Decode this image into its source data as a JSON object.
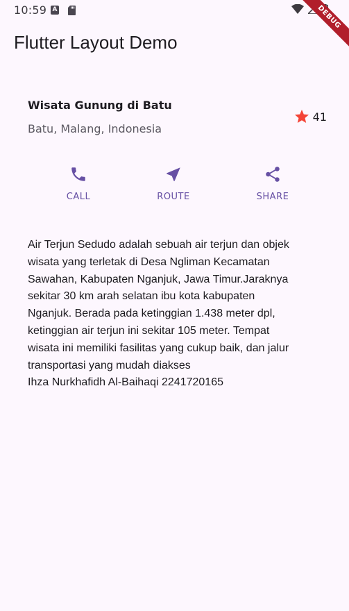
{
  "status_bar": {
    "time": "10:59",
    "a_badge": "A"
  },
  "debug_banner": "DEBUG",
  "app_bar": {
    "title": "Flutter Layout Demo"
  },
  "title_section": {
    "name": "Wisata Gunung di Batu",
    "location": "Batu, Malang, Indonesia",
    "rating_count": "41",
    "star_color": "#f44336"
  },
  "buttons": {
    "call_label": "CALL",
    "route_label": "ROUTE",
    "share_label": "SHARE",
    "accent_color": "#6750a4"
  },
  "description": {
    "lines": [
      "Air Terjun Sedudo adalah sebuah air terjun dan objek",
      "wisata yang terletak di Desa Ngliman Kecamatan",
      "Sawahan, Kabupaten Nganjuk, Jawa Timur.Jaraknya",
      "sekitar 30 km arah selatan ibu kota kabupaten",
      "Nganjuk. Berada pada ketinggian 1.438 meter dpl,",
      "ketinggian air terjun ini sekitar 105 meter. Tempat",
      "wisata ini memiliki fasilitas yang cukup baik, dan jalur",
      "transportasi yang mudah diakses",
      "Ihza Nurkhafidh Al-Baihaqi 2241720165"
    ]
  },
  "icons": {
    "phone": "phone-icon",
    "route": "near-me-icon",
    "share": "share-icon",
    "star": "star-icon",
    "wifi": "wifi-icon",
    "signal": "signal-icon",
    "battery": "battery-icon",
    "sd": "sd-card-icon"
  }
}
